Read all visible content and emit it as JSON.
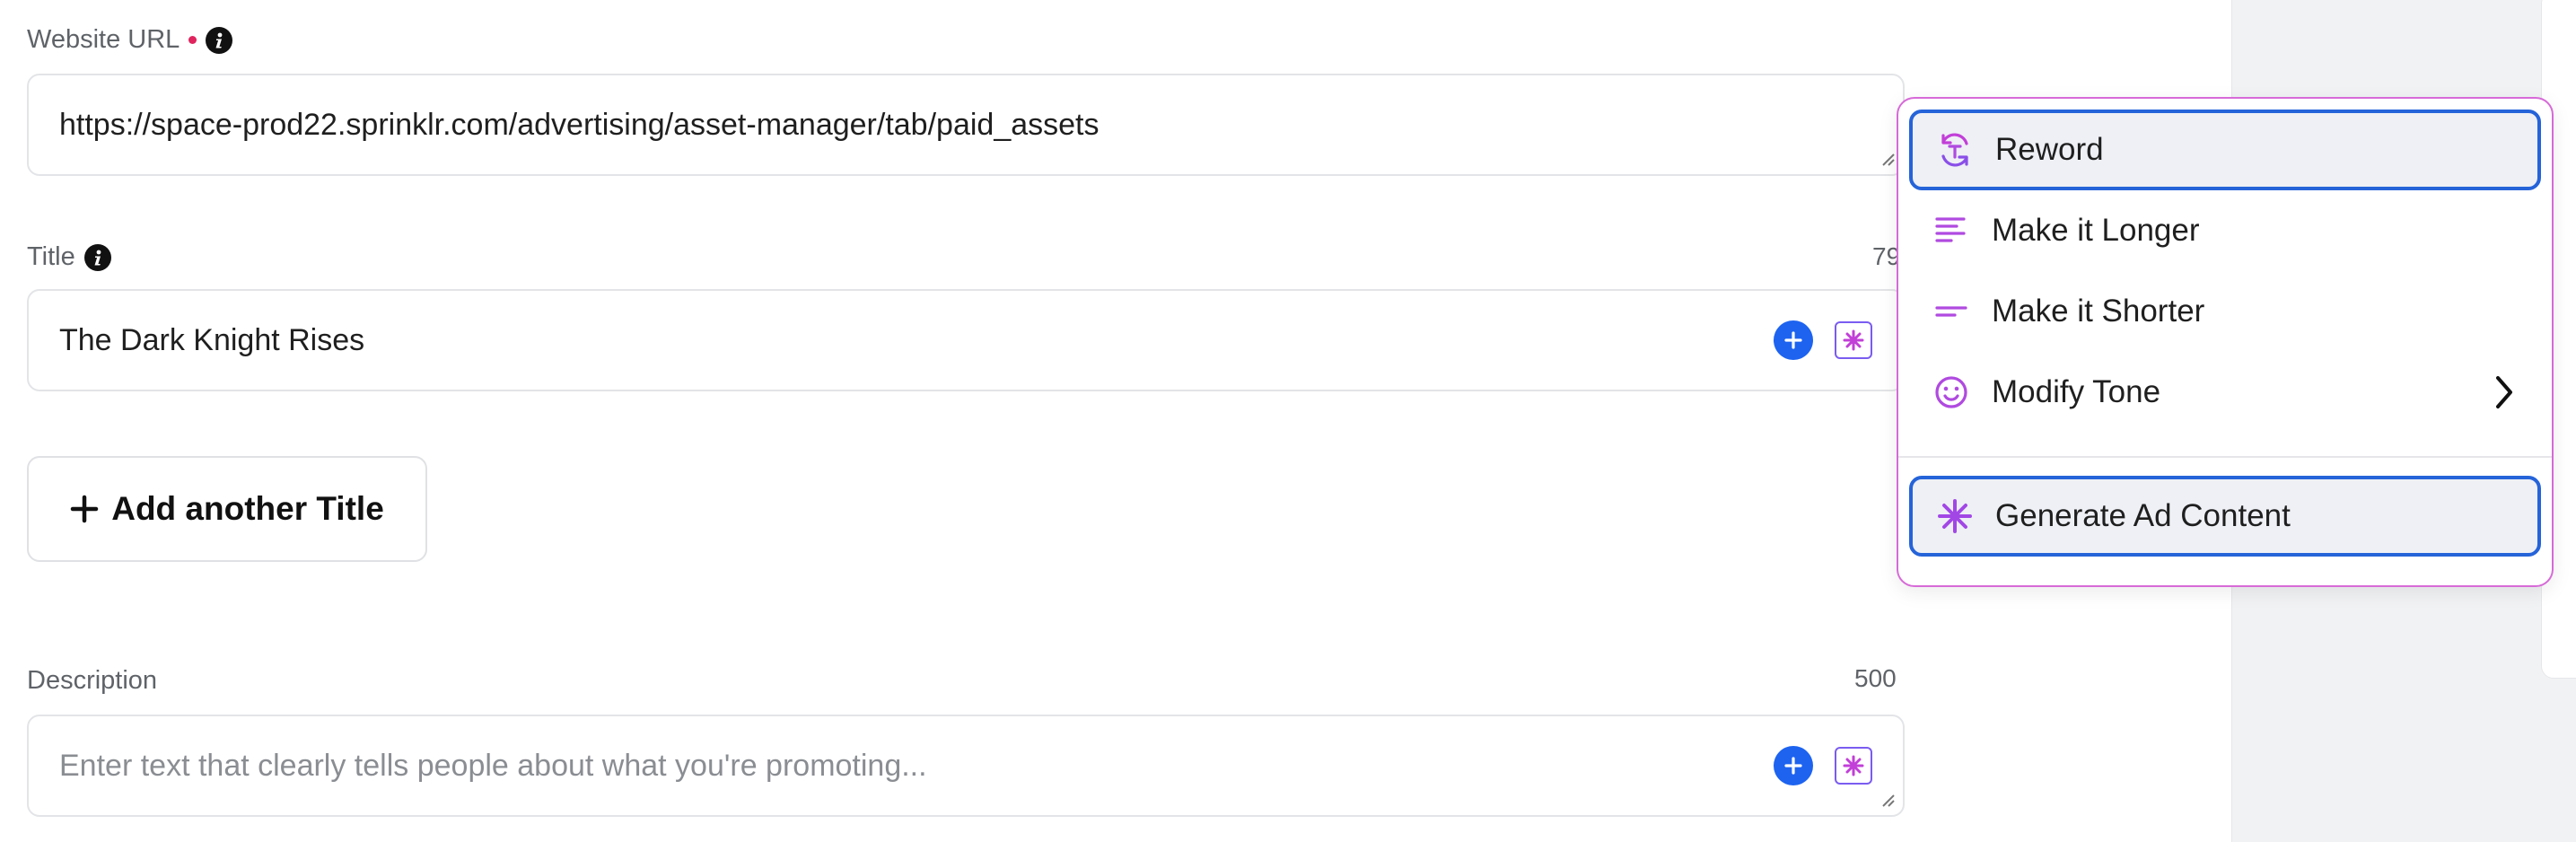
{
  "website_url": {
    "label": "Website URL",
    "value": "https://space-prod22.sprinklr.com/advertising/asset-manager/tab/paid_assets"
  },
  "title_field": {
    "label": "Title",
    "counter": "79",
    "value": "The Dark Knight Rises"
  },
  "add_title_button": {
    "label": "Add another Title"
  },
  "description_field": {
    "label": "Description",
    "counter": "500",
    "placeholder": "Enter text that clearly tells people about what you're promoting..."
  },
  "ai_menu": {
    "items": [
      {
        "label": "Reword",
        "icon": "reword-icon"
      },
      {
        "label": "Make it Longer",
        "icon": "lines-long-icon"
      },
      {
        "label": "Make it Shorter",
        "icon": "lines-short-icon"
      },
      {
        "label": "Modify Tone",
        "icon": "smiley-icon"
      }
    ],
    "generate": {
      "label": "Generate Ad Content",
      "icon": "sparkle-icon"
    }
  },
  "colors": {
    "accent_blue": "#1d63f0",
    "ai_purple": "#9b4fe0",
    "required_dot": "#e0245e"
  }
}
